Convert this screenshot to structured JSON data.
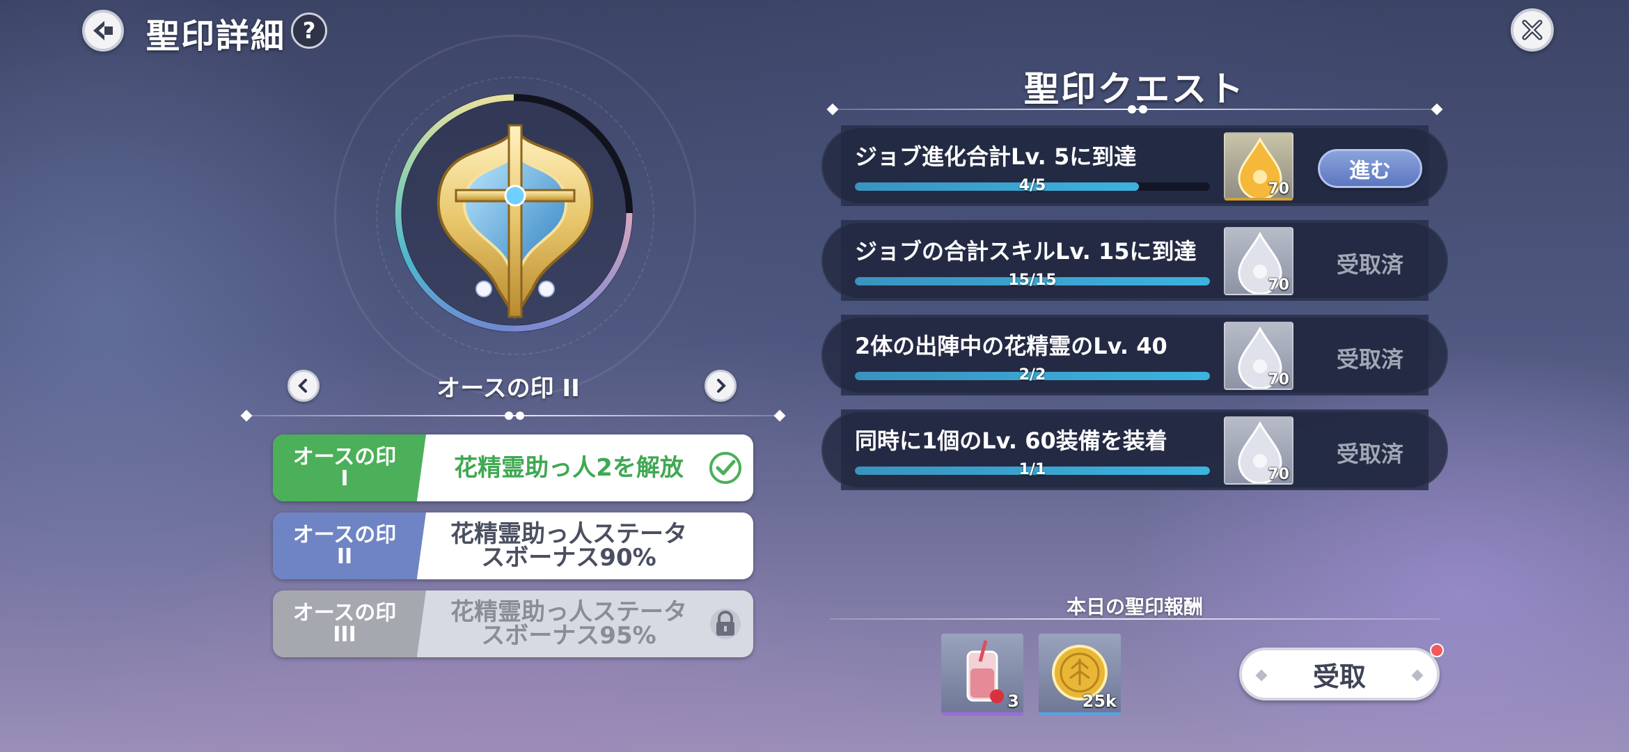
{
  "header": {
    "title": "聖印詳細",
    "help_label": "?"
  },
  "seal": {
    "current_name": "オースの印 II",
    "tiers": [
      {
        "label": "オースの印\nI",
        "description": "花精霊助っ人2を解放",
        "state": "unlocked",
        "color": "#4caf5a"
      },
      {
        "label": "オースの印\nII",
        "description": "花精霊助っ人ステータ\nスボーナス90%",
        "state": "current",
        "color": "#6e84c4"
      },
      {
        "label": "オースの印\nIII",
        "description": "花精霊助っ人ステータ\nスボーナス95%",
        "state": "locked",
        "color": "#a6a8b0"
      }
    ]
  },
  "quests": {
    "title": "聖印クエスト",
    "items": [
      {
        "text": "ジョブ進化合計Lv. 5に到達",
        "progress_text": "4/5",
        "progress": 0.8,
        "reward_qty": "70",
        "reward_icon": "gold-drop-icon",
        "action": "進む",
        "status": "in-progress"
      },
      {
        "text": "ジョブの合計スキルLv. 15に到達",
        "progress_text": "15/15",
        "progress": 1.0,
        "reward_qty": "70",
        "reward_icon": "silver-drop-icon",
        "action": "受取済",
        "status": "claimed"
      },
      {
        "text": "2体の出陣中の花精霊のLv. 40",
        "progress_text": "2/2",
        "progress": 1.0,
        "reward_qty": "70",
        "reward_icon": "silver-drop-icon",
        "action": "受取済",
        "status": "claimed"
      },
      {
        "text": "同時に1個のLv. 60装備を装着",
        "progress_text": "1/1",
        "progress": 1.0,
        "reward_qty": "70",
        "reward_icon": "silver-drop-icon",
        "action": "受取済",
        "status": "claimed"
      }
    ]
  },
  "daily_reward": {
    "title": "本日の聖印報酬",
    "items": [
      {
        "icon": "strawberry-drink-icon",
        "qty": "3"
      },
      {
        "icon": "gold-coin-icon",
        "qty": "25k"
      }
    ],
    "claim_label": "受取"
  },
  "colors": {
    "green": "#4caf5a",
    "blue": "#6e84c4",
    "gray": "#a6a8b0",
    "bar": "#3cb3df",
    "notification": "#f05a5a"
  }
}
